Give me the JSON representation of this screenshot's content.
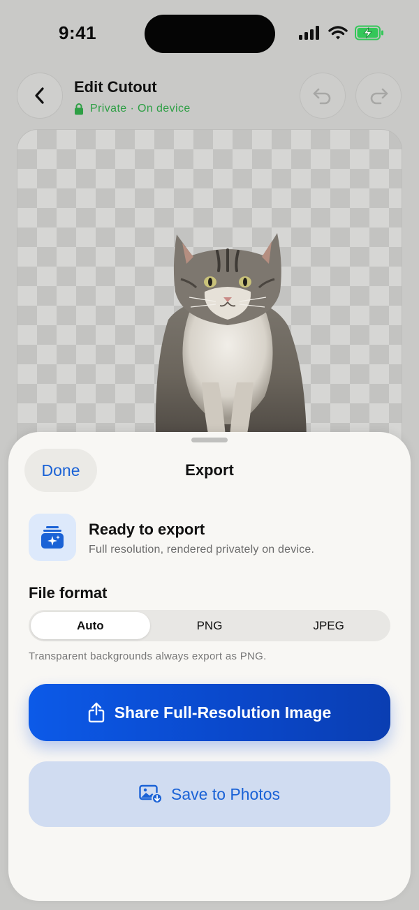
{
  "status_bar": {
    "time": "9:41",
    "icons": [
      "cellular-signal-icon",
      "wifi-icon",
      "battery-charging-icon"
    ]
  },
  "header": {
    "title": "Edit Cutout",
    "subtitle": "Private · On device",
    "subtitle_icon": "lock-icon",
    "subtitle_color": "#2e9f45",
    "buttons": [
      "back-icon",
      "undo-icon",
      "redo-icon"
    ]
  },
  "canvas": {
    "background": "transparent-checkerboard",
    "subject": "cat-cutout"
  },
  "sheet": {
    "done_label": "Done",
    "title": "Export",
    "ready": {
      "icon": "stack-sparkle-icon",
      "title": "Ready to export",
      "subtitle": "Full resolution, rendered privately on device."
    },
    "format": {
      "label": "File format",
      "options": [
        "Auto",
        "PNG",
        "JPEG"
      ],
      "selected": "Auto",
      "hint": "Transparent backgrounds always export as PNG."
    },
    "share_button": {
      "label": "Share Full-Resolution Image",
      "icon": "share-icon"
    },
    "save_button": {
      "label": "Save to Photos",
      "icon": "photo-download-icon"
    }
  },
  "colors": {
    "accent": "#1a62d6",
    "primary_button": "#0c5ae8",
    "secondary_button": "#d0dcf1",
    "battery": "#34c759"
  }
}
